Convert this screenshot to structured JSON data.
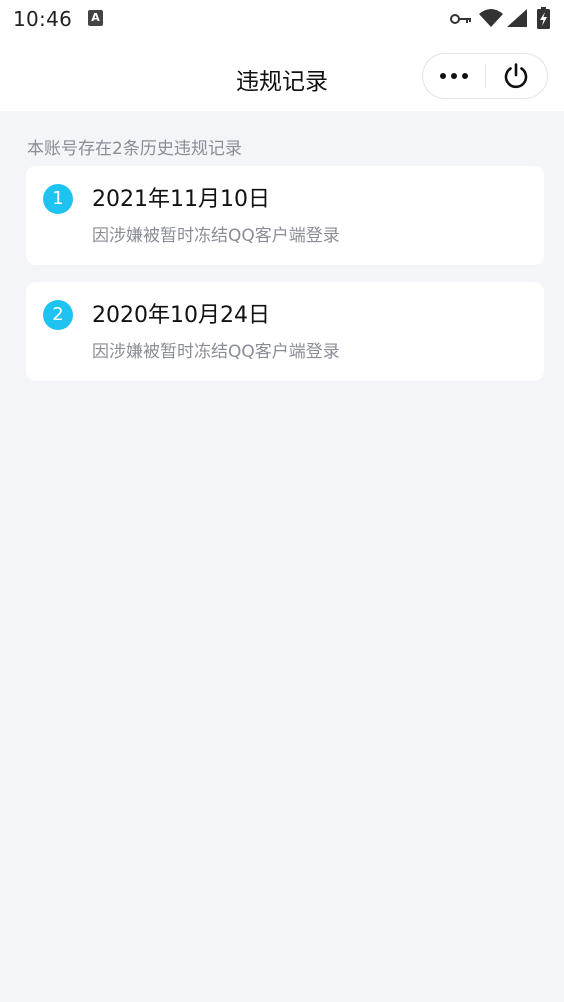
{
  "status_bar": {
    "time": "10:46",
    "notification_letter": "A",
    "icons": [
      "key-icon",
      "wifi-icon",
      "signal-icon",
      "battery-charging-icon"
    ]
  },
  "nav": {
    "title": "违规记录",
    "more_icon": "more-dots-icon",
    "power_icon": "power-icon"
  },
  "summary": "本账号存在2条历史违规记录",
  "records": [
    {
      "index": "1",
      "date": "2021年11月10日",
      "description": "因涉嫌被暂时冻结QQ客户端登录"
    },
    {
      "index": "2",
      "date": "2020年10月24日",
      "description": "因涉嫌被暂时冻结QQ客户端登录"
    }
  ],
  "colors": {
    "accent": "#1fc3f2",
    "background": "#f4f5f9",
    "card": "#ffffff",
    "secondary_text": "#8a8d96"
  }
}
